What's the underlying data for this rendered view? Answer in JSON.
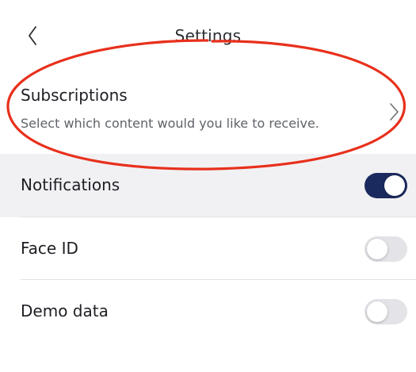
{
  "header": {
    "title": "Settings",
    "back_icon": "chevron-left-icon"
  },
  "subscriptions": {
    "title": "Subscriptions",
    "description": "Select which content would you like to receive.",
    "chevron_icon": "chevron-right-icon"
  },
  "settings": [
    {
      "label": "Notifications",
      "enabled": true
    },
    {
      "label": "Face ID",
      "enabled": false
    },
    {
      "label": "Demo data",
      "enabled": false
    }
  ],
  "colors": {
    "toggle_on": "#1b2a5e",
    "toggle_off": "#e3e3e8",
    "highlight_row": "#f1f1f4",
    "annotation": "#e8301c"
  }
}
